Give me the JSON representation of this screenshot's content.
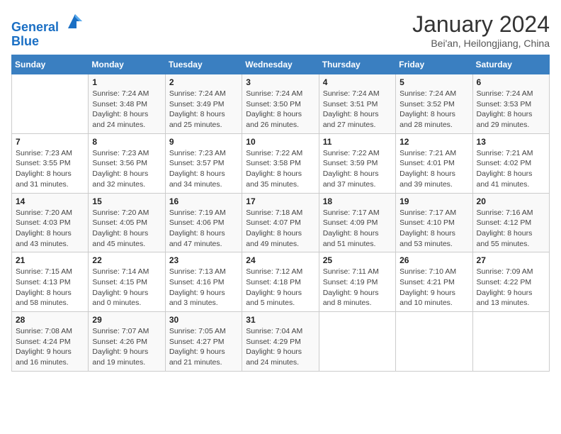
{
  "header": {
    "logo_line1": "General",
    "logo_line2": "Blue",
    "month_title": "January 2024",
    "subtitle": "Bei'an, Heilongjiang, China"
  },
  "days_of_week": [
    "Sunday",
    "Monday",
    "Tuesday",
    "Wednesday",
    "Thursday",
    "Friday",
    "Saturday"
  ],
  "weeks": [
    [
      {
        "day": "",
        "sunrise": "",
        "sunset": "",
        "daylight": ""
      },
      {
        "day": "1",
        "sunrise": "Sunrise: 7:24 AM",
        "sunset": "Sunset: 3:48 PM",
        "daylight": "Daylight: 8 hours and 24 minutes."
      },
      {
        "day": "2",
        "sunrise": "Sunrise: 7:24 AM",
        "sunset": "Sunset: 3:49 PM",
        "daylight": "Daylight: 8 hours and 25 minutes."
      },
      {
        "day": "3",
        "sunrise": "Sunrise: 7:24 AM",
        "sunset": "Sunset: 3:50 PM",
        "daylight": "Daylight: 8 hours and 26 minutes."
      },
      {
        "day": "4",
        "sunrise": "Sunrise: 7:24 AM",
        "sunset": "Sunset: 3:51 PM",
        "daylight": "Daylight: 8 hours and 27 minutes."
      },
      {
        "day": "5",
        "sunrise": "Sunrise: 7:24 AM",
        "sunset": "Sunset: 3:52 PM",
        "daylight": "Daylight: 8 hours and 28 minutes."
      },
      {
        "day": "6",
        "sunrise": "Sunrise: 7:24 AM",
        "sunset": "Sunset: 3:53 PM",
        "daylight": "Daylight: 8 hours and 29 minutes."
      }
    ],
    [
      {
        "day": "7",
        "sunrise": "Sunrise: 7:23 AM",
        "sunset": "Sunset: 3:55 PM",
        "daylight": "Daylight: 8 hours and 31 minutes."
      },
      {
        "day": "8",
        "sunrise": "Sunrise: 7:23 AM",
        "sunset": "Sunset: 3:56 PM",
        "daylight": "Daylight: 8 hours and 32 minutes."
      },
      {
        "day": "9",
        "sunrise": "Sunrise: 7:23 AM",
        "sunset": "Sunset: 3:57 PM",
        "daylight": "Daylight: 8 hours and 34 minutes."
      },
      {
        "day": "10",
        "sunrise": "Sunrise: 7:22 AM",
        "sunset": "Sunset: 3:58 PM",
        "daylight": "Daylight: 8 hours and 35 minutes."
      },
      {
        "day": "11",
        "sunrise": "Sunrise: 7:22 AM",
        "sunset": "Sunset: 3:59 PM",
        "daylight": "Daylight: 8 hours and 37 minutes."
      },
      {
        "day": "12",
        "sunrise": "Sunrise: 7:21 AM",
        "sunset": "Sunset: 4:01 PM",
        "daylight": "Daylight: 8 hours and 39 minutes."
      },
      {
        "day": "13",
        "sunrise": "Sunrise: 7:21 AM",
        "sunset": "Sunset: 4:02 PM",
        "daylight": "Daylight: 8 hours and 41 minutes."
      }
    ],
    [
      {
        "day": "14",
        "sunrise": "Sunrise: 7:20 AM",
        "sunset": "Sunset: 4:03 PM",
        "daylight": "Daylight: 8 hours and 43 minutes."
      },
      {
        "day": "15",
        "sunrise": "Sunrise: 7:20 AM",
        "sunset": "Sunset: 4:05 PM",
        "daylight": "Daylight: 8 hours and 45 minutes."
      },
      {
        "day": "16",
        "sunrise": "Sunrise: 7:19 AM",
        "sunset": "Sunset: 4:06 PM",
        "daylight": "Daylight: 8 hours and 47 minutes."
      },
      {
        "day": "17",
        "sunrise": "Sunrise: 7:18 AM",
        "sunset": "Sunset: 4:07 PM",
        "daylight": "Daylight: 8 hours and 49 minutes."
      },
      {
        "day": "18",
        "sunrise": "Sunrise: 7:17 AM",
        "sunset": "Sunset: 4:09 PM",
        "daylight": "Daylight: 8 hours and 51 minutes."
      },
      {
        "day": "19",
        "sunrise": "Sunrise: 7:17 AM",
        "sunset": "Sunset: 4:10 PM",
        "daylight": "Daylight: 8 hours and 53 minutes."
      },
      {
        "day": "20",
        "sunrise": "Sunrise: 7:16 AM",
        "sunset": "Sunset: 4:12 PM",
        "daylight": "Daylight: 8 hours and 55 minutes."
      }
    ],
    [
      {
        "day": "21",
        "sunrise": "Sunrise: 7:15 AM",
        "sunset": "Sunset: 4:13 PM",
        "daylight": "Daylight: 8 hours and 58 minutes."
      },
      {
        "day": "22",
        "sunrise": "Sunrise: 7:14 AM",
        "sunset": "Sunset: 4:15 PM",
        "daylight": "Daylight: 9 hours and 0 minutes."
      },
      {
        "day": "23",
        "sunrise": "Sunrise: 7:13 AM",
        "sunset": "Sunset: 4:16 PM",
        "daylight": "Daylight: 9 hours and 3 minutes."
      },
      {
        "day": "24",
        "sunrise": "Sunrise: 7:12 AM",
        "sunset": "Sunset: 4:18 PM",
        "daylight": "Daylight: 9 hours and 5 minutes."
      },
      {
        "day": "25",
        "sunrise": "Sunrise: 7:11 AM",
        "sunset": "Sunset: 4:19 PM",
        "daylight": "Daylight: 9 hours and 8 minutes."
      },
      {
        "day": "26",
        "sunrise": "Sunrise: 7:10 AM",
        "sunset": "Sunset: 4:21 PM",
        "daylight": "Daylight: 9 hours and 10 minutes."
      },
      {
        "day": "27",
        "sunrise": "Sunrise: 7:09 AM",
        "sunset": "Sunset: 4:22 PM",
        "daylight": "Daylight: 9 hours and 13 minutes."
      }
    ],
    [
      {
        "day": "28",
        "sunrise": "Sunrise: 7:08 AM",
        "sunset": "Sunset: 4:24 PM",
        "daylight": "Daylight: 9 hours and 16 minutes."
      },
      {
        "day": "29",
        "sunrise": "Sunrise: 7:07 AM",
        "sunset": "Sunset: 4:26 PM",
        "daylight": "Daylight: 9 hours and 19 minutes."
      },
      {
        "day": "30",
        "sunrise": "Sunrise: 7:05 AM",
        "sunset": "Sunset: 4:27 PM",
        "daylight": "Daylight: 9 hours and 21 minutes."
      },
      {
        "day": "31",
        "sunrise": "Sunrise: 7:04 AM",
        "sunset": "Sunset: 4:29 PM",
        "daylight": "Daylight: 9 hours and 24 minutes."
      },
      {
        "day": "",
        "sunrise": "",
        "sunset": "",
        "daylight": ""
      },
      {
        "day": "",
        "sunrise": "",
        "sunset": "",
        "daylight": ""
      },
      {
        "day": "",
        "sunrise": "",
        "sunset": "",
        "daylight": ""
      }
    ]
  ]
}
